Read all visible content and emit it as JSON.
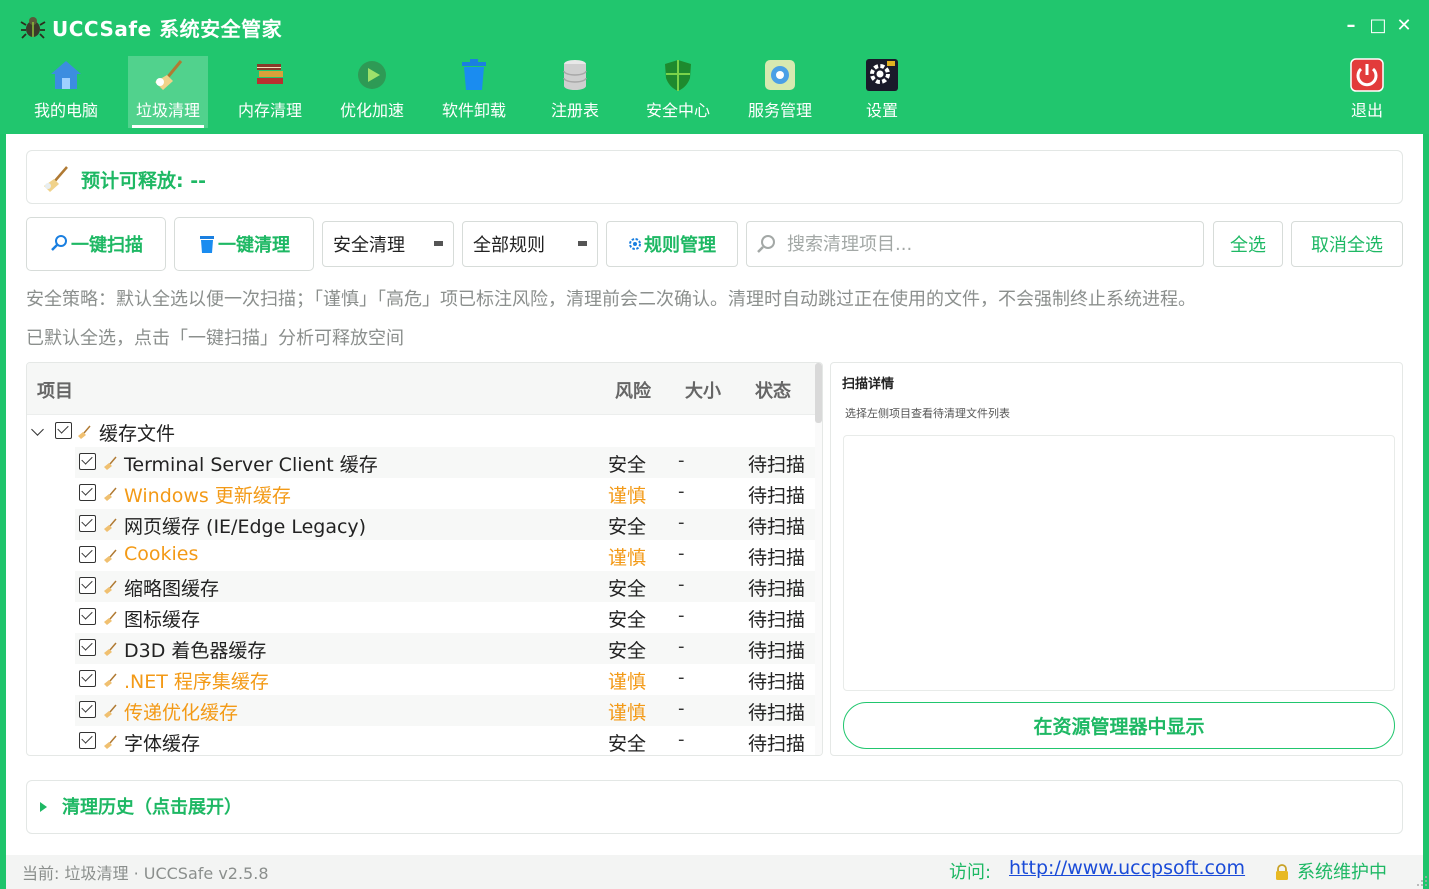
{
  "app": {
    "title": "UCCSafe 系统安全管家"
  },
  "window_controls": {
    "minimize": "–",
    "maximize": "□",
    "close": "✕"
  },
  "nav": {
    "items": [
      {
        "label": "我的电脑",
        "icon": "home-icon"
      },
      {
        "label": "垃圾清理",
        "icon": "broom-icon",
        "active": true
      },
      {
        "label": "内存清理",
        "icon": "books-icon"
      },
      {
        "label": "优化加速",
        "icon": "play-icon"
      },
      {
        "label": "软件卸载",
        "icon": "trash-icon"
      },
      {
        "label": "注册表",
        "icon": "database-icon"
      },
      {
        "label": "安全中心",
        "icon": "shield-icon"
      },
      {
        "label": "服务管理",
        "icon": "services-icon"
      },
      {
        "label": "设置",
        "icon": "gear-icon"
      }
    ],
    "exit": {
      "label": "退出",
      "icon": "power-icon"
    }
  },
  "release": {
    "label": "预计可释放: --"
  },
  "toolbar": {
    "scan_label": "一键扫描",
    "clean_label": "一键清理",
    "mode_select": "安全清理",
    "rule_select": "全部规则",
    "rule_manage_label": "规则管理",
    "search_placeholder": "搜索清理项目...",
    "select_all_label": "全选",
    "deselect_all_label": "取消全选"
  },
  "policy_text": "安全策略：默认全选以便一次扫描；「谨慎」「高危」项已标注风险，清理前会二次确认。清理时自动跳过正在使用的文件，不会强制终止系统进程。",
  "hint_text": "已默认全选，点击「一键扫描」分析可释放空间",
  "table": {
    "headers": {
      "item": "项目",
      "risk": "风险",
      "size": "大小",
      "status": "状态"
    },
    "group": {
      "label": "缓存文件",
      "checked": true,
      "expanded": true
    },
    "rows": [
      {
        "label": "Terminal Server Client 缓存",
        "risk": "安全",
        "size": "-",
        "status": "待扫描",
        "warn": false
      },
      {
        "label": "Windows 更新缓存",
        "risk": "谨慎",
        "size": "-",
        "status": "待扫描",
        "warn": true
      },
      {
        "label": "网页缓存 (IE/Edge Legacy)",
        "risk": "安全",
        "size": "-",
        "status": "待扫描",
        "warn": false
      },
      {
        "label": "Cookies",
        "risk": "谨慎",
        "size": "-",
        "status": "待扫描",
        "warn": true
      },
      {
        "label": "缩略图缓存",
        "risk": "安全",
        "size": "-",
        "status": "待扫描",
        "warn": false
      },
      {
        "label": "图标缓存",
        "risk": "安全",
        "size": "-",
        "status": "待扫描",
        "warn": false
      },
      {
        "label": "D3D 着色器缓存",
        "risk": "安全",
        "size": "-",
        "status": "待扫描",
        "warn": false
      },
      {
        "label": ".NET 程序集缓存",
        "risk": "谨慎",
        "size": "-",
        "status": "待扫描",
        "warn": true
      },
      {
        "label": "传递优化缓存",
        "risk": "谨慎",
        "size": "-",
        "status": "待扫描",
        "warn": true
      },
      {
        "label": "字体缓存",
        "risk": "安全",
        "size": "-",
        "status": "待扫描",
        "warn": false
      }
    ]
  },
  "detail": {
    "title": "扫描详情",
    "subtitle": "选择左侧项目查看待清理文件列表",
    "reveal_label": "在资源管理器中显示"
  },
  "history": {
    "label": "清理历史（点击展开）"
  },
  "statusbar": {
    "current": "当前: 垃圾清理 · UCCSafe v2.5.8",
    "visit_label": "访问:",
    "link": "http://www.uccpsoft.com",
    "maintenance": "系统维护中"
  },
  "colors": {
    "brand": "#21c66e",
    "accent": "#1eb864",
    "warn": "#f39a17",
    "link": "#1a4bd8"
  }
}
